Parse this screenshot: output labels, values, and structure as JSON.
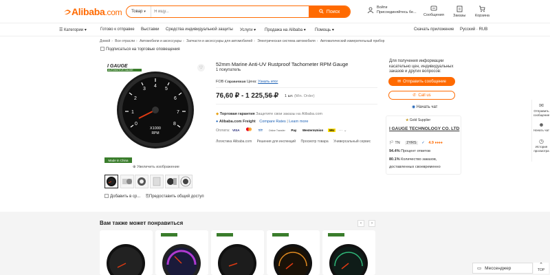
{
  "header": {
    "logo": "Alibaba",
    "logo_suffix": ".com",
    "search_category": "Товар",
    "search_placeholder": "Я ищу...",
    "search_button": "Поиск",
    "signin_line1": "Войти",
    "signin_line2": "Присоединяйтесь бе...",
    "messages": "Сообщения",
    "orders": "Заказы",
    "cart": "Корзина"
  },
  "nav": {
    "categories": "Категории",
    "items": [
      "Готово к отправке",
      "Выставки",
      "Средства индивидуальной защиты",
      "Услуги",
      "Продажа на Alibaba",
      "Помощь"
    ],
    "app": "Скачать приложение",
    "lang": "Русский · RUB"
  },
  "breadcrumb": [
    "Домой",
    "Все отрасли",
    "Автомобили и аксессуары",
    "Запчасти и аксессуары для автомобилей",
    "Электрическая система автомобиля",
    "Автоматический измерительный прибор"
  ],
  "subscribe": "Подписаться на торговые оповещения",
  "gallery": {
    "badge": "I GAUGE",
    "badge_sub": "AUTOMOTIVE GAUGE",
    "made_in": "Made in China",
    "enlarge": "Увеличить изображение",
    "add_compare": "Добавить в ср...",
    "share": "Предоставить общий доступ",
    "gauge_label": "X1000",
    "gauge_unit": "RPM",
    "gauge_numbers": [
      "0",
      "1",
      "2",
      "3",
      "4",
      "5",
      "6",
      "7",
      "8"
    ]
  },
  "product": {
    "title": "52mm Marine Anti-UV Rustproof Tachometer RPM Gauge",
    "sellers": "1 покупатель",
    "fob_label": "FOB",
    "fob_ref": "Справочная",
    "fob_price": "Цена:",
    "fob_link": "Узнать итог",
    "price": "76,60 ₽ - 1 225,56 ₽",
    "price_unit": "/ шт.",
    "min_order": "1 шт.",
    "min_order_note": "(Min. Order)",
    "guarantee_label": "Торговая гарантия",
    "guarantee_text": "Защитите свои заказы на Alibaba.com",
    "freight_label": "Alibaba.com Freight",
    "freight_compare": "Compare Rates",
    "freight_learn": "Learn more",
    "payment_label": "Оплата:",
    "payments": [
      "VISA",
      "MC",
      "T/T",
      "Online Transfer",
      "Pay",
      "WesternUnion",
      "WU"
    ],
    "services": [
      "Логистика Alibaba.com",
      "Решения для инспекций",
      "Просмотр товара",
      "Универсальный сервис"
    ]
  },
  "contact": {
    "info": "Для получения информации касательно цен, индивидуальных заказов и других вопросов:",
    "send": "Отправить сообщение",
    "call": "Call us",
    "chat": "Начать чат"
  },
  "supplier": {
    "gold": "Gold Supplier",
    "name": "I GAUGE TECHNOLOGY CO. LTD",
    "country": "TN",
    "years": "2YRS",
    "rating": "4.9",
    "resp_rate": "94.4%",
    "resp_label": "Процент ответов",
    "order_rate": "80.1%",
    "order_label": "Количество заказов,",
    "order_label2": "доставленных своевременно"
  },
  "sidebar": {
    "send": "Отправить сообщение",
    "chat": "Начать чат",
    "history": "История просмотра"
  },
  "recommend": {
    "title": "Вам также может понравиться"
  },
  "messenger": "Мессенджер",
  "top": "TOP"
}
